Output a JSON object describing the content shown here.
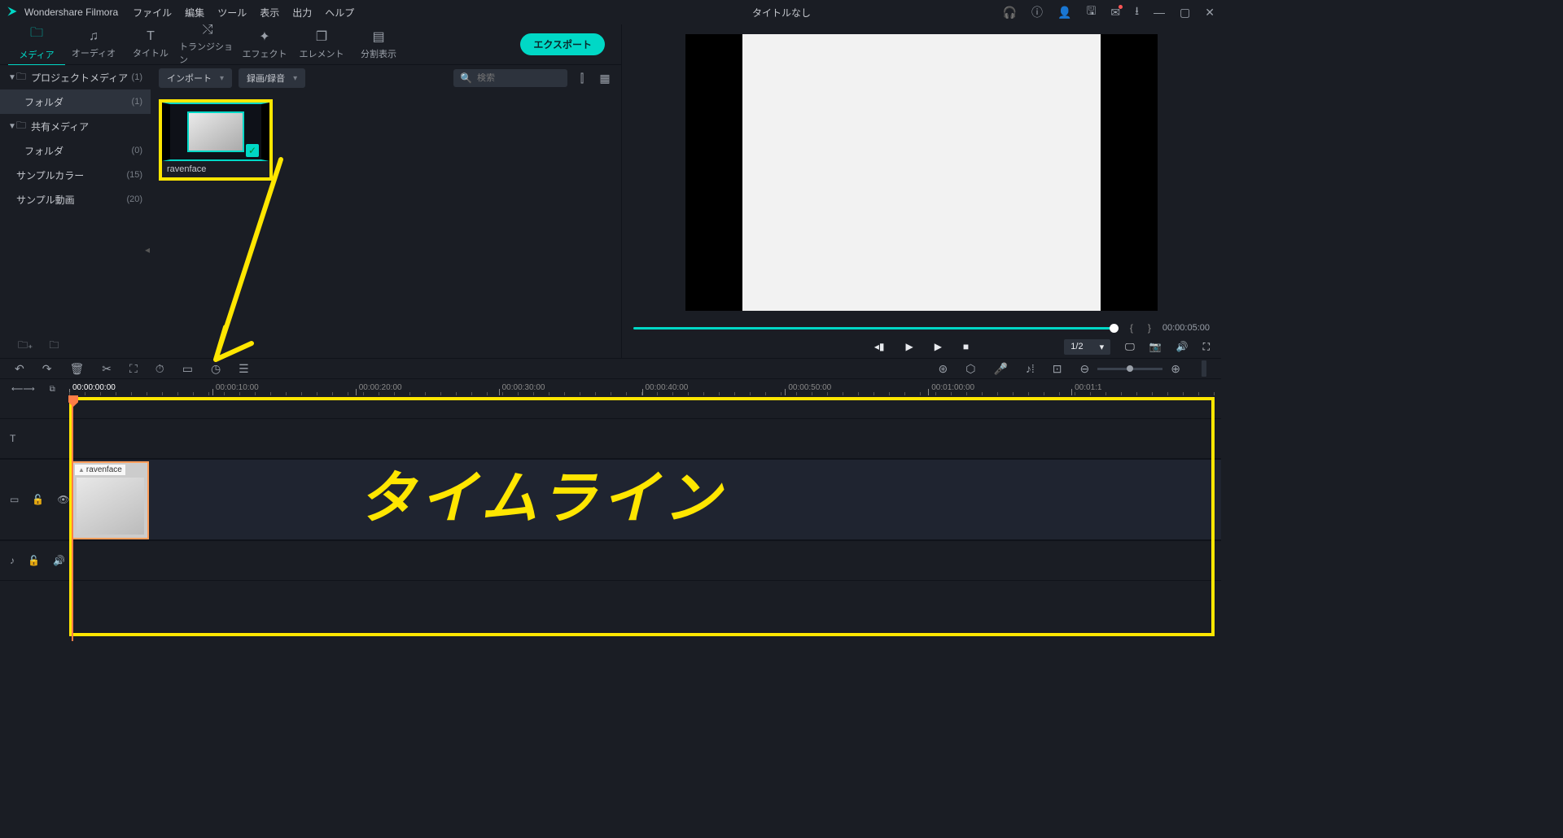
{
  "app": {
    "name": "Wondershare Filmora",
    "title": "タイトルなし"
  },
  "menus": {
    "file": "ファイル",
    "edit": "編集",
    "tool": "ツール",
    "view": "表示",
    "output": "出力",
    "help": "ヘルプ"
  },
  "tabs": {
    "media": "メディア",
    "audio": "オーディオ",
    "title": "タイトル",
    "transition": "トランジション",
    "effect": "エフェクト",
    "element": "エレメント",
    "split": "分割表示"
  },
  "export": "エクスポート",
  "sidebar": {
    "projectMedia": "プロジェクトメディア",
    "projectCount": "(1)",
    "folder": "フォルダ",
    "folderCount": "(1)",
    "sharedMedia": "共有メディア",
    "sharedFolder": "フォルダ",
    "sharedFolderCount": "(0)",
    "sampleColor": "サンプルカラー",
    "sampleColorCount": "(15)",
    "sampleVideo": "サンプル動画",
    "sampleVideoCount": "(20)"
  },
  "mediaToolbar": {
    "import": "インポート",
    "record": "録画/録音",
    "searchPlaceholder": "検索"
  },
  "mediaItem": {
    "name": "ravenface"
  },
  "preview": {
    "duration": "00:00:05:00",
    "ratio": "1/2"
  },
  "timeline": {
    "playheadTime": "00:00:00:00",
    "marks": [
      "00:00:10:00",
      "00:00:20:00",
      "00:00:30:00",
      "00:00:40:00",
      "00:00:50:00",
      "00:01:00:00",
      "00:01:1"
    ],
    "clipName": "ravenface",
    "annotation": "タイムライン"
  }
}
